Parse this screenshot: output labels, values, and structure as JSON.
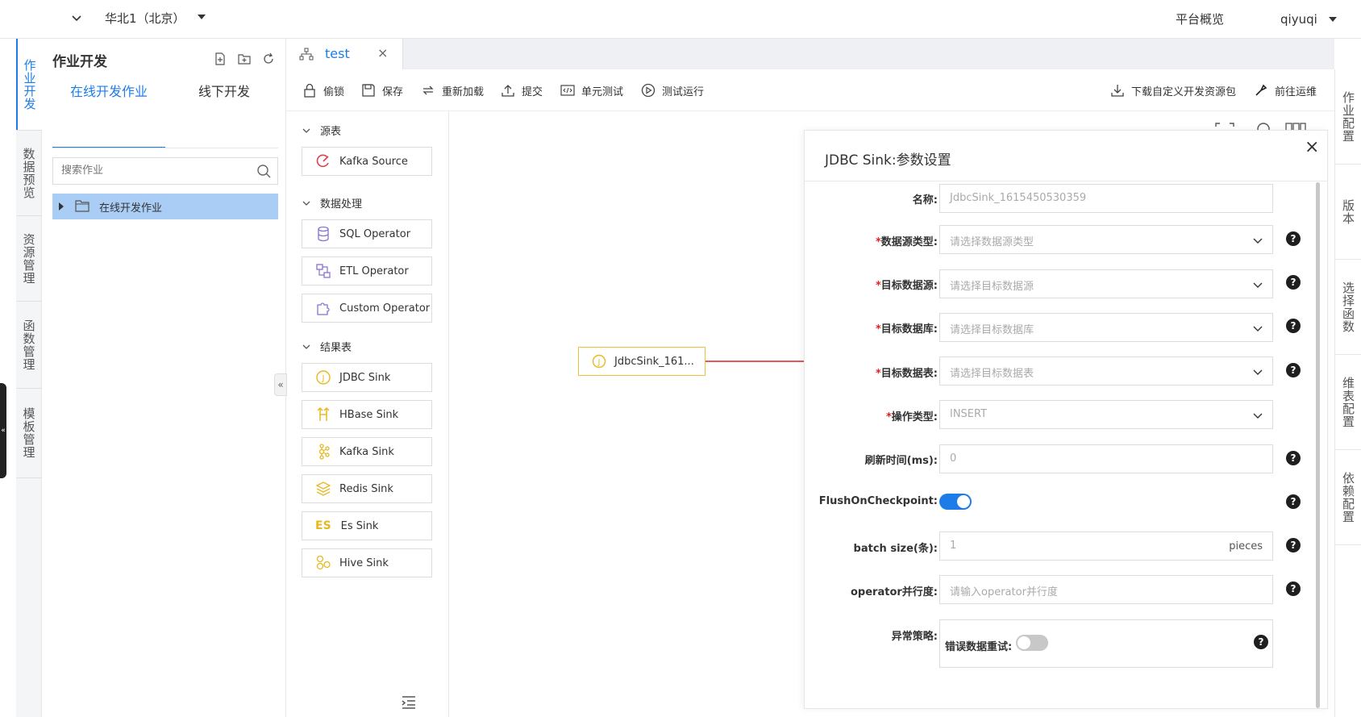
{
  "topbar": {
    "region": "华北1（北京）",
    "overview": "平台概览",
    "user": "qiyuqi"
  },
  "leftnav": {
    "items": [
      {
        "label": "作业开发",
        "active": true
      },
      {
        "label": "数据预览"
      },
      {
        "label": "资源管理"
      },
      {
        "label": "函数管理"
      },
      {
        "label": "模板管理"
      }
    ]
  },
  "jobpanel": {
    "title": "作业开发",
    "tabs": [
      "在线开发作业",
      "线下开发"
    ],
    "search_placeholder": "搜索作业",
    "tree": [
      {
        "label": "在线开发作业",
        "selected": true
      }
    ]
  },
  "editor": {
    "tab_label": "test",
    "toolbar": {
      "lock": "偷锁",
      "save": "保存",
      "reload": "重新加载",
      "submit": "提交",
      "unit_test": "单元测试",
      "test_run": "测试运行",
      "download": "下载自定义开发资源包",
      "goto_ops": "前往运维"
    }
  },
  "rightnav": {
    "items": [
      "作业配置",
      "版本",
      "选择函数",
      "维表配置",
      "依赖配置"
    ]
  },
  "palette": {
    "groups": [
      {
        "label": "源表",
        "items": [
          "Kafka Source"
        ]
      },
      {
        "label": "数据处理",
        "items": [
          "SQL Operator",
          "ETL Operator",
          "Custom Operator"
        ]
      },
      {
        "label": "结果表",
        "items": [
          "JDBC Sink",
          "HBase Sink",
          "Kafka Sink",
          "Redis Sink",
          "Es Sink",
          "Hive Sink"
        ]
      }
    ],
    "es_badge": "ES"
  },
  "canvas": {
    "node_label": "JdbcSink_161...",
    "node_icon_letter": "J"
  },
  "settings": {
    "title": "JDBC Sink:参数设置",
    "close": "×",
    "fields": {
      "name": {
        "label": "名称:",
        "value": "JdbcSink_1615450530359"
      },
      "ds_type": {
        "label": "数据源类型:",
        "placeholder": "请选择数据源类型"
      },
      "target_ds": {
        "label": "目标数据源:",
        "placeholder": "请选择目标数据源"
      },
      "target_db": {
        "label": "目标数据库:",
        "placeholder": "请选择目标数据库"
      },
      "target_table": {
        "label": "目标数据表:",
        "placeholder": "请选择目标数据表"
      },
      "op_type": {
        "label": "操作类型:",
        "value": "INSERT"
      },
      "refresh": {
        "label": "刷新时间(ms):",
        "value": "0"
      },
      "flush": {
        "label": "FlushOnCheckpoint:",
        "enabled": true
      },
      "batch": {
        "label": "batch size(条):",
        "value": "1",
        "suffix": "pieces"
      },
      "parallel": {
        "label": "operator并行度:",
        "placeholder": "请输入operator并行度"
      },
      "error_policy": {
        "label": "异常策略:",
        "retry_label": "错误数据重试:",
        "retry_enabled": false
      }
    },
    "required_mark": "*",
    "help_glyph": "?"
  },
  "colors": {
    "accent": "#1e7ce8",
    "selected_row": "#a9cdf5",
    "node_border": "#f0c040",
    "required": "#e02020",
    "arrow": "#e02020"
  }
}
